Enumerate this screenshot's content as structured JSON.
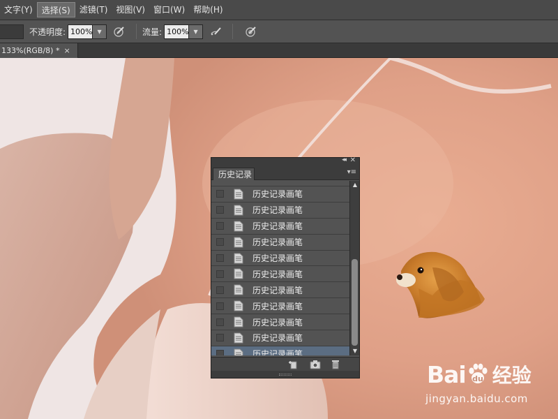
{
  "menubar": {
    "items": [
      {
        "label": "文字(Y)"
      },
      {
        "label": "选择(S)"
      },
      {
        "label": "滤镜(T)"
      },
      {
        "label": "视图(V)"
      },
      {
        "label": "窗口(W)"
      },
      {
        "label": "帮助(H)"
      }
    ]
  },
  "options": {
    "opacity_label": "不透明度:",
    "opacity_value": "100%",
    "flow_label": "流量:",
    "flow_value": "100%"
  },
  "document": {
    "tab_title": "133%(RGB/8) *",
    "tab_close": "×"
  },
  "history_panel": {
    "title": "历史记录",
    "items": [
      {
        "label": "历史记录画笔"
      },
      {
        "label": "历史记录画笔"
      },
      {
        "label": "历史记录画笔"
      },
      {
        "label": "历史记录画笔"
      },
      {
        "label": "历史记录画笔"
      },
      {
        "label": "历史记录画笔"
      },
      {
        "label": "历史记录画笔"
      },
      {
        "label": "历史记录画笔"
      },
      {
        "label": "历史记录画笔"
      },
      {
        "label": "历史记录画笔"
      },
      {
        "label": "历史记录画笔"
      }
    ],
    "selected_index": 10
  },
  "watermark": {
    "brand_text": "Bai",
    "brand_suffix": "经验",
    "url": "jingyan.baidu.com"
  },
  "colors": {
    "menubar_bg": "#4a4a4a",
    "panel_bg": "#535353",
    "selected_row": "#5b6d82"
  }
}
